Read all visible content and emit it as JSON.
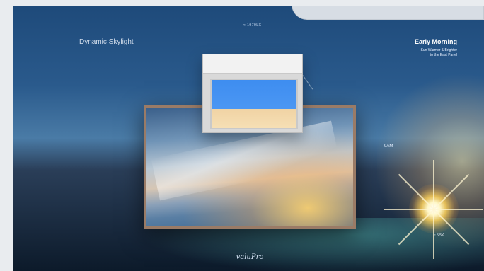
{
  "brand": "Dynamic Skylight",
  "top_small": "≈ 1970LX",
  "mode": {
    "title": "Early Morning",
    "subtitle": "Sun Warmer & Brighter\nto the East Panel"
  },
  "time_label": "9AM",
  "bottom_right_label": "≈ 5.5K",
  "logo_text": "valuPro"
}
